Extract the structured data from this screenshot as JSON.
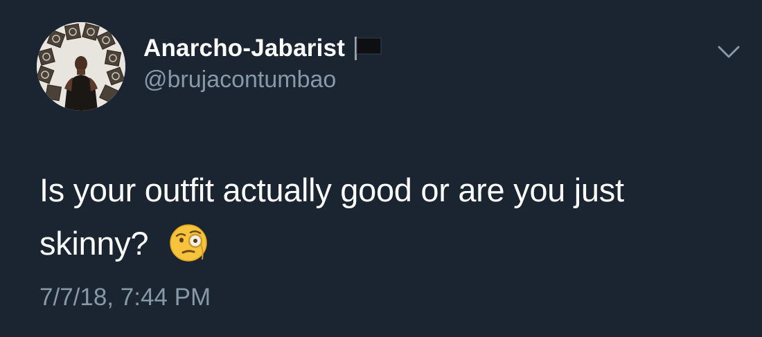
{
  "tweet": {
    "display_name": "Anarcho-Jabarist",
    "handle": "@brujacontumbao",
    "text": "Is your outfit actually good or are you just skinny?",
    "timestamp": "7/7/18, 7:44 PM",
    "icons": {
      "name_flag": "black-flag-icon",
      "menu": "chevron-down-icon",
      "emoji": "face-with-monocle-icon"
    }
  },
  "colors": {
    "background": "#1b2431",
    "primary_text": "#ffffff",
    "secondary_text": "#8899a6"
  }
}
